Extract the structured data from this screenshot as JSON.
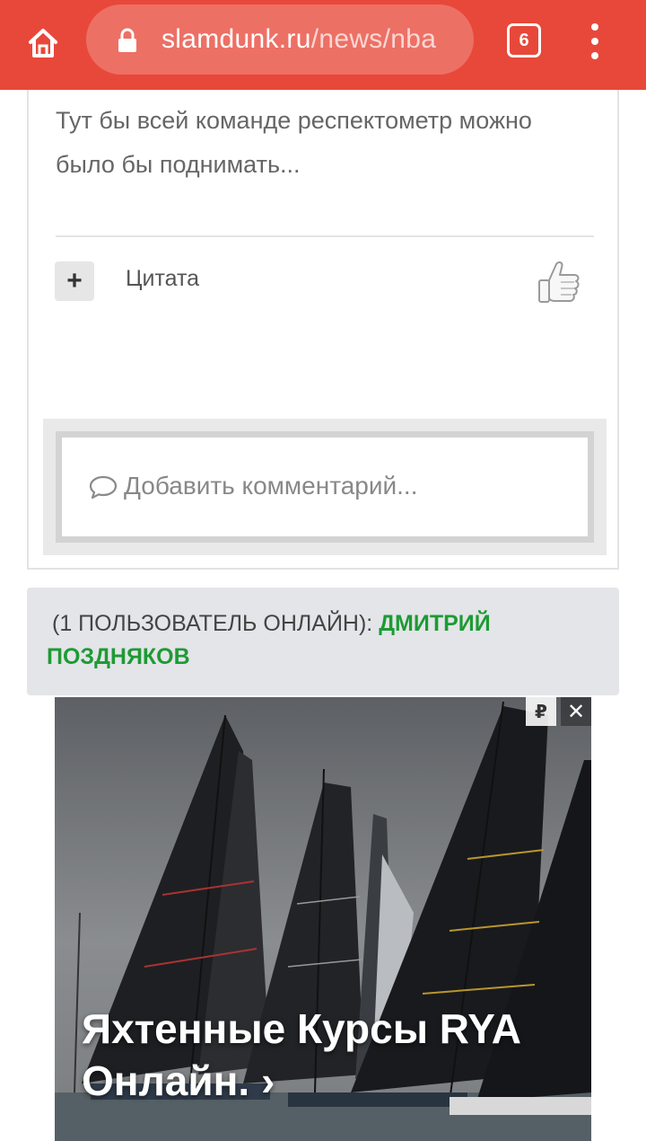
{
  "browser": {
    "url_domain": "slamdunk.ru",
    "url_path": "/news/nba",
    "tab_count": "6",
    "icons": {
      "home": "home-icon",
      "lock": "lock-icon",
      "menu": "more-vert-icon"
    },
    "toolbar_color": "#e8483a"
  },
  "comment": {
    "text": "Тут бы всей команде респектометр можно было бы поднимать...",
    "quote_button": "+",
    "quote_label": "Цитата",
    "like_icon": "thumbs-up-icon"
  },
  "add_comment": {
    "placeholder": "Добавить комментарий...",
    "icon": "speech-bubble-icon"
  },
  "online": {
    "prefix": "(1 пользователь онлайн):",
    "user": "Дмитрий Поздняков",
    "user_color": "#1e9a34"
  },
  "ad": {
    "title": "Яхтенные Курсы RYA Онлайн. ›",
    "ruble_badge": "₽",
    "close": "✕"
  }
}
